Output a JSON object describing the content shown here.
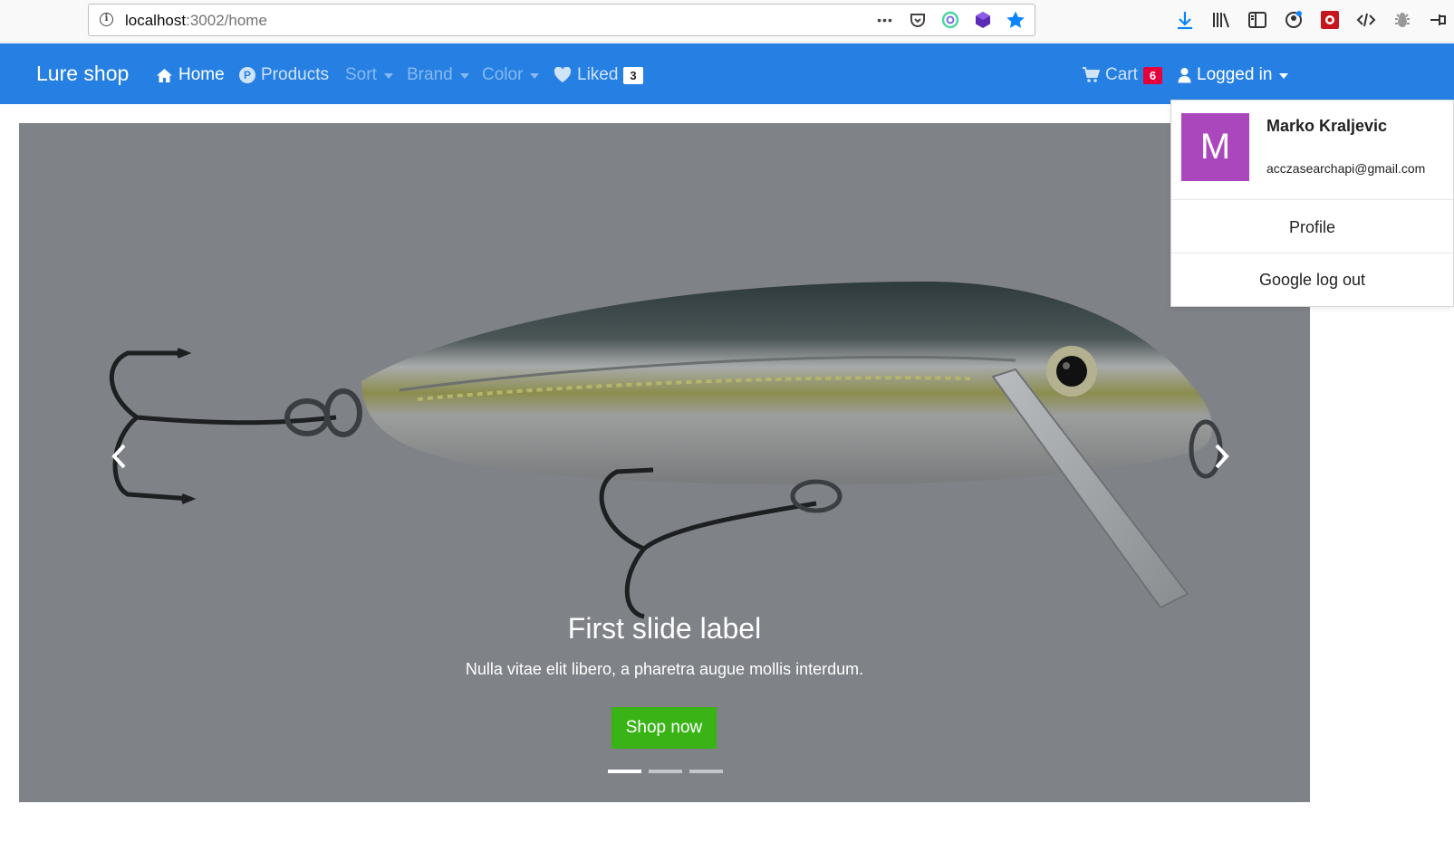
{
  "browser": {
    "url_host": "localhost",
    "url_path": ":3002/home",
    "more_label": "•••"
  },
  "navbar": {
    "brand": "Lure shop",
    "home": "Home",
    "products": "Products",
    "products_icon_letter": "P",
    "sort": "Sort",
    "brand_menu": "Brand",
    "color": "Color",
    "liked": "Liked",
    "liked_count": "3",
    "cart": "Cart",
    "cart_count": "6",
    "logged_in": "Logged in"
  },
  "carousel": {
    "title": "First slide label",
    "text": "Nulla vitae elit libero, a pharetra augue mollis interdum.",
    "button": "Shop now",
    "indicators": [
      true,
      false,
      false
    ]
  },
  "user_menu": {
    "avatar_letter": "M",
    "name": "Marko Kraljevic",
    "email": "acczasearchapi@gmail.com",
    "profile": "Profile",
    "logout": "Google log out"
  },
  "colors": {
    "navbar": "#2680e3",
    "shop_button": "#3ab317",
    "cart_badge": "#e5003b",
    "avatar": "#ab47bc"
  }
}
